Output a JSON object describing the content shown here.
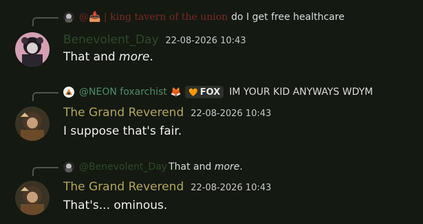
{
  "colors": {
    "background": "#141912",
    "benevolent_name": "#2e4a2a",
    "reverend_name": "#b5a65a",
    "neon_name": "#4f8d6a",
    "king_name": "#7a2a22",
    "timestamp": "#c8c8c8"
  },
  "messages": [
    {
      "reply": {
        "author": "@📥 | king tavern of the union",
        "text": "do I get free healthcare"
      },
      "author": "Benevolent_Day",
      "timestamp": "22-08-2026 10:43",
      "text_plain": "That and ",
      "text_em": "more",
      "text_tail": "."
    },
    {
      "reply": {
        "author": "@NEON foxarchist",
        "emoji": "🦊",
        "tag_icon": "🧡",
        "tag": "FOX",
        "text": "IM YOUR KID ANYWAYS WDYM"
      },
      "author": "The Grand Reverend",
      "timestamp": "22-08-2026 10:43",
      "text": "I suppose that's fair."
    },
    {
      "reply": {
        "author": "@Benevolent_Day",
        "text_plain": "That and ",
        "text_em": "more",
        "text_tail": "."
      },
      "author": "The Grand Reverend",
      "timestamp": "22-08-2026 10:43",
      "text": "That's... ominous."
    }
  ]
}
